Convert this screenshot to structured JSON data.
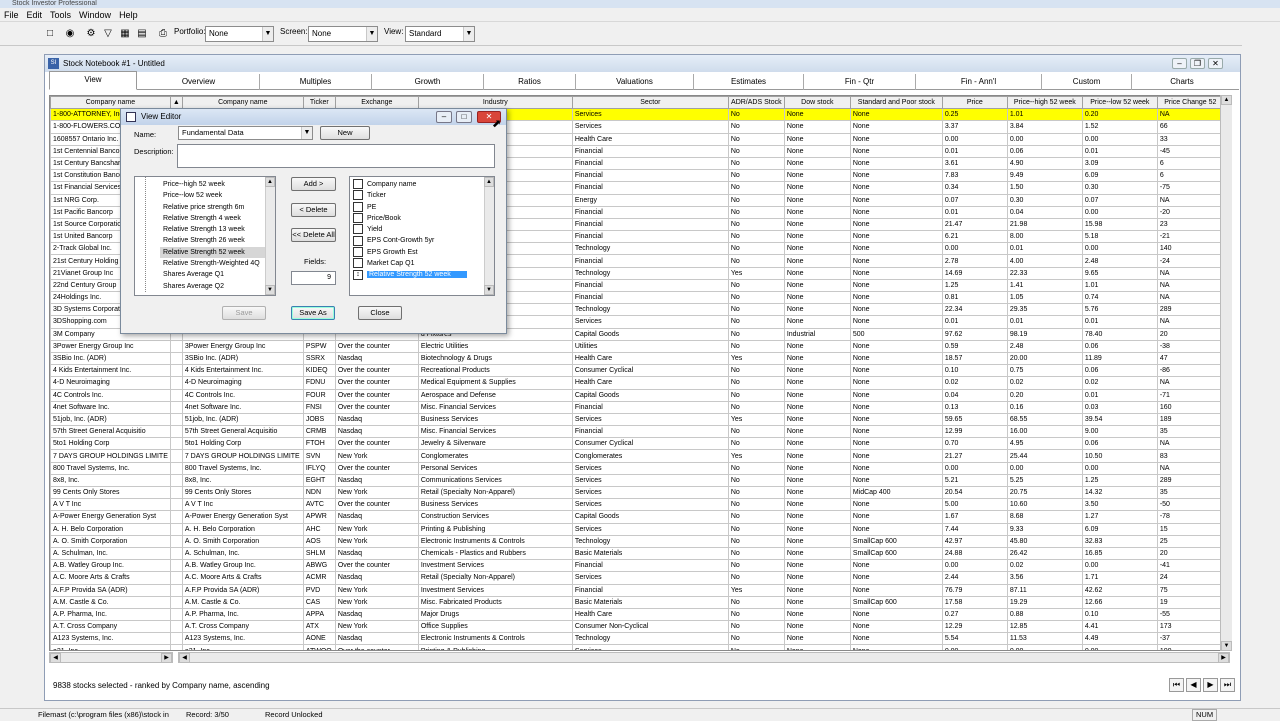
{
  "app": {
    "title": "Stock Investor Professional"
  },
  "menu": [
    "File",
    "Edit",
    "Tools",
    "Window",
    "Help"
  ],
  "toolbar": {
    "portfolio_label": "Portfolio:",
    "portfolio_value": "None",
    "screen_label": "Screen:",
    "screen_value": "None",
    "view_label": "View:",
    "view_value": "Standard",
    "icons": [
      "new-icon",
      "binoculars-icon",
      "tools-icon",
      "filter-icon",
      "report-icon",
      "chart-icon",
      "print-icon"
    ]
  },
  "notebook": {
    "title": "Stock Notebook #1 - Untitled",
    "tabs": [
      "View",
      "Overview",
      "Multiples",
      "Growth",
      "Ratios",
      "Valuations",
      "Estimates",
      "Fin - Qtr",
      "Fin - Ann'l",
      "Custom",
      "Charts"
    ]
  },
  "grid": {
    "headers": [
      "Company name",
      "Company name",
      "Ticker",
      "Exchange",
      "Industry",
      "Sector",
      "ADR/ADS Stock",
      "Dow stock",
      "Standard and Poor stock",
      "Price",
      "Price--high 52 week",
      "Price--low 52 week",
      "Price Change 52"
    ],
    "rows": [
      [
        "1-800-ATTORNEY, Inc.",
        "",
        "",
        "",
        "",
        "Services",
        "No",
        "None",
        "None",
        "0.25",
        "1.01",
        "0.20",
        "NA"
      ],
      [
        "1-800-FLOWERS.COM",
        "",
        "",
        "",
        "rel)",
        "Services",
        "No",
        "None",
        "None",
        "3.37",
        "3.84",
        "1.52",
        "66"
      ],
      [
        "1608557 Ontario Inc.",
        "",
        "",
        "",
        "",
        "Health Care",
        "No",
        "None",
        "None",
        "0.00",
        "0.00",
        "0.00",
        "33"
      ],
      [
        "1st Centennial Bancorp",
        "",
        "",
        "",
        "",
        "Financial",
        "No",
        "None",
        "None",
        "0.01",
        "0.06",
        "0.01",
        "-45"
      ],
      [
        "1st Century Bancshares",
        "",
        "",
        "",
        "",
        "Financial",
        "No",
        "None",
        "None",
        "3.61",
        "4.90",
        "3.09",
        "6"
      ],
      [
        "1st Constitution Bancorp",
        "",
        "",
        "",
        "",
        "Financial",
        "No",
        "None",
        "None",
        "7.83",
        "9.49",
        "6.09",
        "6"
      ],
      [
        "1st Financial Services",
        "",
        "",
        "",
        "",
        "Financial",
        "No",
        "None",
        "None",
        "0.34",
        "1.50",
        "0.30",
        "-75"
      ],
      [
        "1st NRG Corp.",
        "",
        "",
        "",
        "",
        "Energy",
        "No",
        "None",
        "None",
        "0.07",
        "0.30",
        "0.07",
        "NA"
      ],
      [
        "1st Pacific Bancorp",
        "",
        "",
        "",
        "",
        "Financial",
        "No",
        "None",
        "None",
        "0.01",
        "0.04",
        "0.00",
        "-20"
      ],
      [
        "1st Source Corporation",
        "",
        "",
        "",
        "",
        "Financial",
        "No",
        "None",
        "None",
        "21.47",
        "21.98",
        "15.98",
        "23"
      ],
      [
        "1st United Bancorp",
        "",
        "",
        "",
        "",
        "Financial",
        "No",
        "None",
        "None",
        "6.21",
        "8.00",
        "5.18",
        "-21"
      ],
      [
        "2-Track Global Inc.",
        "",
        "",
        "",
        "",
        "Technology",
        "No",
        "None",
        "None",
        "0.00",
        "0.01",
        "0.00",
        "140"
      ],
      [
        "21st Century Holding",
        "",
        "",
        "",
        "ually)",
        "Financial",
        "No",
        "None",
        "None",
        "2.78",
        "4.00",
        "2.48",
        "-24"
      ],
      [
        "21Vianet Group Inc",
        "",
        "",
        "",
        "",
        "Technology",
        "Yes",
        "None",
        "None",
        "14.69",
        "22.33",
        "9.65",
        "NA"
      ],
      [
        "22nd Century Group",
        "",
        "",
        "",
        "",
        "Financial",
        "No",
        "None",
        "None",
        "1.25",
        "1.41",
        "1.01",
        "NA"
      ],
      [
        "24Holdings Inc.",
        "",
        "",
        "",
        "",
        "Financial",
        "No",
        "None",
        "None",
        "0.81",
        "1.05",
        "0.74",
        "NA"
      ],
      [
        "3D Systems Corporation",
        "",
        "",
        "",
        "",
        "Technology",
        "No",
        "None",
        "None",
        "22.34",
        "29.35",
        "5.76",
        "289"
      ],
      [
        "3DShopping.com",
        "",
        "",
        "",
        "",
        "Services",
        "No",
        "None",
        "None",
        "0.01",
        "0.01",
        "0.01",
        "NA"
      ],
      [
        "3M Company",
        "",
        "",
        "",
        "d Fixtures",
        "Capital Goods",
        "No",
        "Industrial",
        "500",
        "97.62",
        "98.19",
        "78.40",
        "20"
      ],
      [
        "3Power Energy Group Inc",
        "3Power Energy Group Inc",
        "PSPW",
        "Over the counter",
        "Electric Utilities",
        "Utilities",
        "No",
        "None",
        "None",
        "0.59",
        "2.48",
        "0.06",
        "-38"
      ],
      [
        "3SBio Inc. (ADR)",
        "3SBio Inc. (ADR)",
        "SSRX",
        "Nasdaq",
        "Biotechnology & Drugs",
        "Health Care",
        "Yes",
        "None",
        "None",
        "18.57",
        "20.00",
        "11.89",
        "47"
      ],
      [
        "4 Kids Entertainment Inc.",
        "4 Kids Entertainment Inc.",
        "KIDEQ",
        "Over the counter",
        "Recreational Products",
        "Consumer Cyclical",
        "No",
        "None",
        "None",
        "0.10",
        "0.75",
        "0.06",
        "-86"
      ],
      [
        "4-D Neuroimaging",
        "4-D Neuroimaging",
        "FDNU",
        "Over the counter",
        "Medical Equipment & Supplies",
        "Health Care",
        "No",
        "None",
        "None",
        "0.02",
        "0.02",
        "0.02",
        "NA"
      ],
      [
        "4C Controls Inc.",
        "4C Controls Inc.",
        "FOUR",
        "Over the counter",
        "Aerospace and Defense",
        "Capital Goods",
        "No",
        "None",
        "None",
        "0.04",
        "0.20",
        "0.01",
        "-71"
      ],
      [
        "4net Software Inc.",
        "4net Software Inc.",
        "FNSI",
        "Over the counter",
        "Misc. Financial Services",
        "Financial",
        "No",
        "None",
        "None",
        "0.13",
        "0.16",
        "0.03",
        "160"
      ],
      [
        "51job, Inc. (ADR)",
        "51job, Inc. (ADR)",
        "JOBS",
        "Nasdaq",
        "Business Services",
        "Services",
        "Yes",
        "None",
        "None",
        "59.65",
        "68.55",
        "39.54",
        "189"
      ],
      [
        "57th Street General Acquisitio",
        "57th Street General Acquisitio",
        "CRMB",
        "Nasdaq",
        "Misc. Financial Services",
        "Financial",
        "No",
        "None",
        "None",
        "12.99",
        "16.00",
        "9.00",
        "35"
      ],
      [
        "5to1 Holding Corp",
        "5to1 Holding Corp",
        "FTOH",
        "Over the counter",
        "Jewelry & Silverware",
        "Consumer Cyclical",
        "No",
        "None",
        "None",
        "0.70",
        "4.95",
        "0.06",
        "NA"
      ],
      [
        "7 DAYS GROUP HOLDINGS LIMITE",
        "7 DAYS GROUP HOLDINGS LIMITE",
        "SVN",
        "New York",
        "Conglomerates",
        "Conglomerates",
        "Yes",
        "None",
        "None",
        "21.27",
        "25.44",
        "10.50",
        "83"
      ],
      [
        "800 Travel Systems, Inc.",
        "800 Travel Systems, Inc.",
        "IFLYQ",
        "Over the counter",
        "Personal Services",
        "Services",
        "No",
        "None",
        "None",
        "0.00",
        "0.00",
        "0.00",
        "NA"
      ],
      [
        "8x8, Inc.",
        "8x8, Inc.",
        "EGHT",
        "Nasdaq",
        "Communications Services",
        "Services",
        "No",
        "None",
        "None",
        "5.21",
        "5.25",
        "1.25",
        "289"
      ],
      [
        "99 Cents Only Stores",
        "99 Cents Only Stores",
        "NDN",
        "New York",
        "Retail (Specialty Non-Apparel)",
        "Services",
        "No",
        "None",
        "MidCap 400",
        "20.54",
        "20.75",
        "14.32",
        "35"
      ],
      [
        "A V T Inc",
        "A V T Inc",
        "AVTC",
        "Over the counter",
        "Business Services",
        "Services",
        "No",
        "None",
        "None",
        "5.00",
        "10.60",
        "3.50",
        "-50"
      ],
      [
        "A-Power Energy Generation Syst",
        "A-Power Energy Generation Syst",
        "APWR",
        "Nasdaq",
        "Construction Services",
        "Capital Goods",
        "No",
        "None",
        "None",
        "1.67",
        "8.68",
        "1.27",
        "-78"
      ],
      [
        "A. H. Belo Corporation",
        "A. H. Belo Corporation",
        "AHC",
        "New York",
        "Printing & Publishing",
        "Services",
        "No",
        "None",
        "None",
        "7.44",
        "9.33",
        "6.09",
        "15"
      ],
      [
        "A. O. Smith Corporation",
        "A. O. Smith Corporation",
        "AOS",
        "New York",
        "Electronic Instruments & Controls",
        "Technology",
        "No",
        "None",
        "SmallCap 600",
        "42.97",
        "45.80",
        "32.83",
        "25"
      ],
      [
        "A. Schulman, Inc.",
        "A. Schulman, Inc.",
        "SHLM",
        "Nasdaq",
        "Chemicals - Plastics and Rubbers",
        "Basic Materials",
        "No",
        "None",
        "SmallCap 600",
        "24.88",
        "26.42",
        "16.85",
        "20"
      ],
      [
        "A.B. Watley Group Inc.",
        "A.B. Watley Group Inc.",
        "ABWG",
        "Over the counter",
        "Investment Services",
        "Financial",
        "No",
        "None",
        "None",
        "0.00",
        "0.02",
        "0.00",
        "-41"
      ],
      [
        "A.C. Moore Arts & Crafts",
        "A.C. Moore Arts & Crafts",
        "ACMR",
        "Nasdaq",
        "Retail (Specialty Non-Apparel)",
        "Services",
        "No",
        "None",
        "None",
        "2.44",
        "3.56",
        "1.71",
        "24"
      ],
      [
        "A.F.P Provida SA (ADR)",
        "A.F.P Provida SA (ADR)",
        "PVD",
        "New York",
        "Investment Services",
        "Financial",
        "Yes",
        "None",
        "None",
        "76.79",
        "87.11",
        "42.62",
        "75"
      ],
      [
        "A.M. Castle & Co.",
        "A.M. Castle & Co.",
        "CAS",
        "New York",
        "Misc. Fabricated Products",
        "Basic Materials",
        "No",
        "None",
        "SmallCap 600",
        "17.58",
        "19.29",
        "12.66",
        "19"
      ],
      [
        "A.P. Pharma, Inc.",
        "A.P. Pharma, Inc.",
        "APPA",
        "Nasdaq",
        "Major Drugs",
        "Health Care",
        "No",
        "None",
        "None",
        "0.27",
        "0.88",
        "0.10",
        "-55"
      ],
      [
        "A.T. Cross Company",
        "A.T. Cross Company",
        "ATX",
        "New York",
        "Office Supplies",
        "Consumer Non-Cyclical",
        "No",
        "None",
        "None",
        "12.29",
        "12.85",
        "4.41",
        "173"
      ],
      [
        "A123 Systems, Inc.",
        "A123 Systems, Inc.",
        "AONE",
        "Nasdaq",
        "Electronic Instruments & Controls",
        "Technology",
        "No",
        "None",
        "None",
        "5.54",
        "11.53",
        "4.49",
        "-37"
      ],
      [
        "a21, Inc.",
        "a21, Inc.",
        "ATWOQ",
        "Over the counter",
        "Printing & Publishing",
        "Services",
        "No",
        "None",
        "None",
        "0.00",
        "0.00",
        "0.00",
        "100"
      ]
    ]
  },
  "view_editor": {
    "title": "View Editor",
    "name_label": "Name:",
    "name_value": "Fundamental Data",
    "new_button": "New",
    "desc_label": "Description:",
    "available": [
      "Price--high 52 week",
      "Price--low 52 week",
      "Relative price strength 6m",
      "Relative Strength  4 week",
      "Relative Strength 13 week",
      "Relative Strength 26 week",
      "Relative Strength 52 week",
      "Relative Strength-Weighted 4Q",
      "Shares Average Q1",
      "Shares Average Q2"
    ],
    "add_button": "Add >",
    "delete_button": "< Delete",
    "delete_all_button": "<< Delete All",
    "fields_label": "Fields:",
    "fields_value": "9",
    "selected": [
      "Company name",
      "Ticker",
      "PE",
      "Price/Book",
      "Yield",
      "EPS Cont-Growth 5yr",
      "EPS Growth Est",
      "Market Cap Q1",
      "Relative Strength 52 week"
    ],
    "save_button": "Save",
    "save_as_button": "Save As",
    "close_button": "Close"
  },
  "info": {
    "selection_text": "9838 stocks selected - ranked by Company name, ascending"
  },
  "status": {
    "path": "Filemast (c:\\program files (x86)\\stock in",
    "record": "Record: 3/50",
    "unlocked": "Record Unlocked",
    "num": "NUM"
  }
}
